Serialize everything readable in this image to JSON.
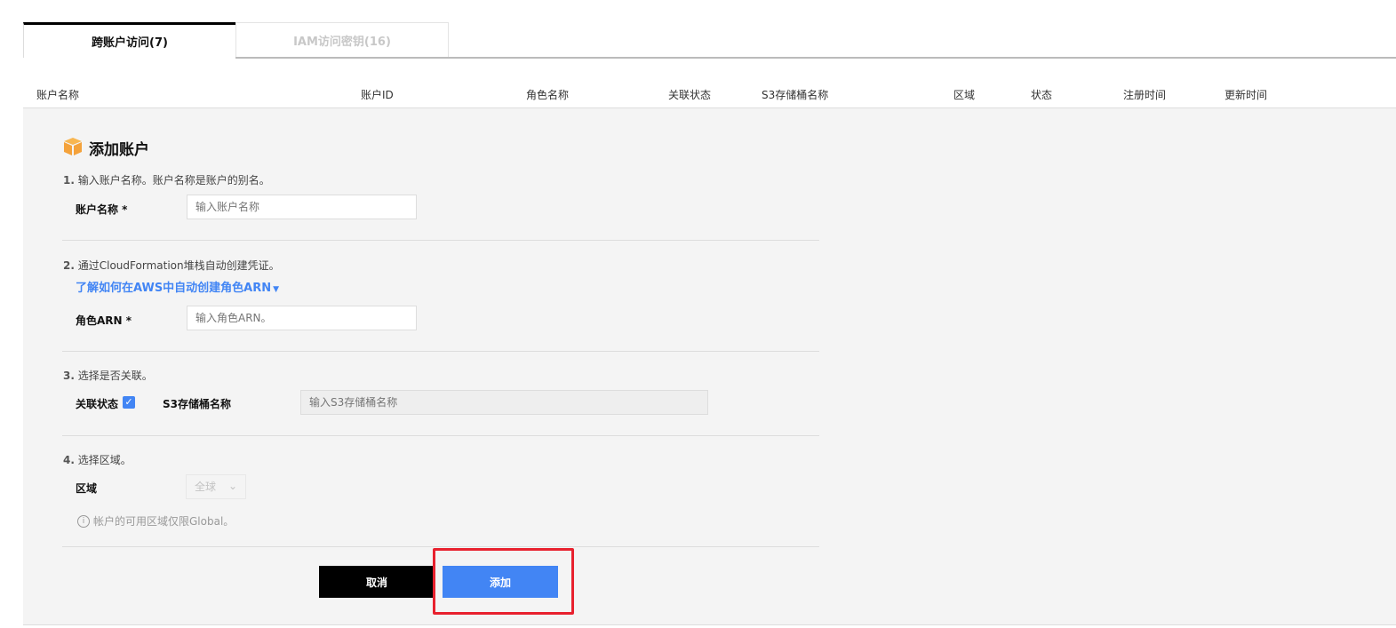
{
  "tabs": [
    {
      "label": "跨账户访问(7)",
      "active": true
    },
    {
      "label": "IAM访问密钥(16)",
      "active": false
    }
  ],
  "table": {
    "columns": [
      "账户名称",
      "账户ID",
      "角色名称",
      "关联状态",
      "S3存储桶名称",
      "区域",
      "状态",
      "注册时间",
      "更新时间"
    ]
  },
  "form": {
    "title": "添加账户",
    "step1": {
      "num": "1.",
      "text": "输入账户名称。账户名称是账户的别名。",
      "label": "账户名称 *",
      "placeholder": "输入账户名称"
    },
    "step2": {
      "num": "2.",
      "text": "通过CloudFormation堆栈自动创建凭证。",
      "link": "了解如何在AWS中自动创建角色ARN",
      "label": "角色ARN *",
      "placeholder": "输入角色ARN。"
    },
    "step3": {
      "num": "3.",
      "text": "选择是否关联。",
      "assoc_label": "关联状态",
      "assoc_checked": true,
      "s3_label": "S3存储桶名称",
      "s3_placeholder": "输入S3存储桶名称"
    },
    "step4": {
      "num": "4.",
      "text": "选择区域。",
      "label": "区域",
      "region_value": "全球",
      "info": "帐户的可用区域仅限Global。"
    },
    "cancel": "取消",
    "add": "添加"
  },
  "colors": {
    "accent": "#4285f4",
    "highlight": "#e8212e",
    "icon": "#f4a23b"
  }
}
